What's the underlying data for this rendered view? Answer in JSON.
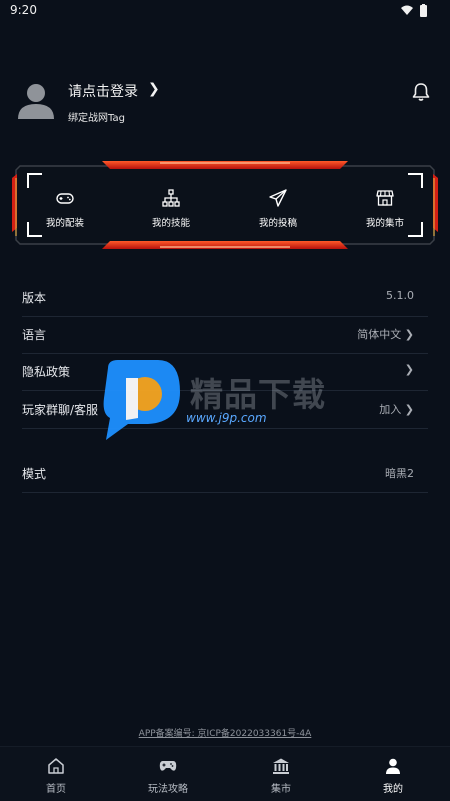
{
  "status": {
    "time": "9:20"
  },
  "profile": {
    "login_text": "请点击登录",
    "chevron": "❯",
    "bind_text": "绑定战网Tag"
  },
  "banner": {
    "items": [
      {
        "label": "我的配装",
        "icon": "gamepad-icon"
      },
      {
        "label": "我的技能",
        "icon": "hierarchy-icon"
      },
      {
        "label": "我的投稿",
        "icon": "paper-plane-icon"
      },
      {
        "label": "我的集市",
        "icon": "store-icon"
      }
    ]
  },
  "settings": [
    {
      "key": "版本",
      "value": "5.1.0"
    },
    {
      "key": "语言",
      "value": "简体中文 ❯"
    },
    {
      "key": "隐私政策",
      "value": "❯"
    },
    {
      "key": "玩家群聊/客服",
      "value": "加入 ❯"
    },
    {
      "key": "模式",
      "value": "暗黑2"
    }
  ],
  "watermark": {
    "text": "精品下载",
    "url": "www.j9p.com"
  },
  "icp": "APP备案编号: 京ICP备2022033361号-4A",
  "tabs": [
    {
      "label": "首页",
      "icon": "home-icon",
      "active": false
    },
    {
      "label": "玩法攻略",
      "icon": "gamepad-icon",
      "active": false
    },
    {
      "label": "集市",
      "icon": "bank-icon",
      "active": false
    },
    {
      "label": "我的",
      "icon": "person-icon",
      "active": true
    }
  ],
  "colors": {
    "background": "#0a101a",
    "accent_red": "#e8261c",
    "accent_gold": "#d9a640",
    "watermark_blue": "#1e90ff",
    "watermark_orange": "#f5a623"
  }
}
